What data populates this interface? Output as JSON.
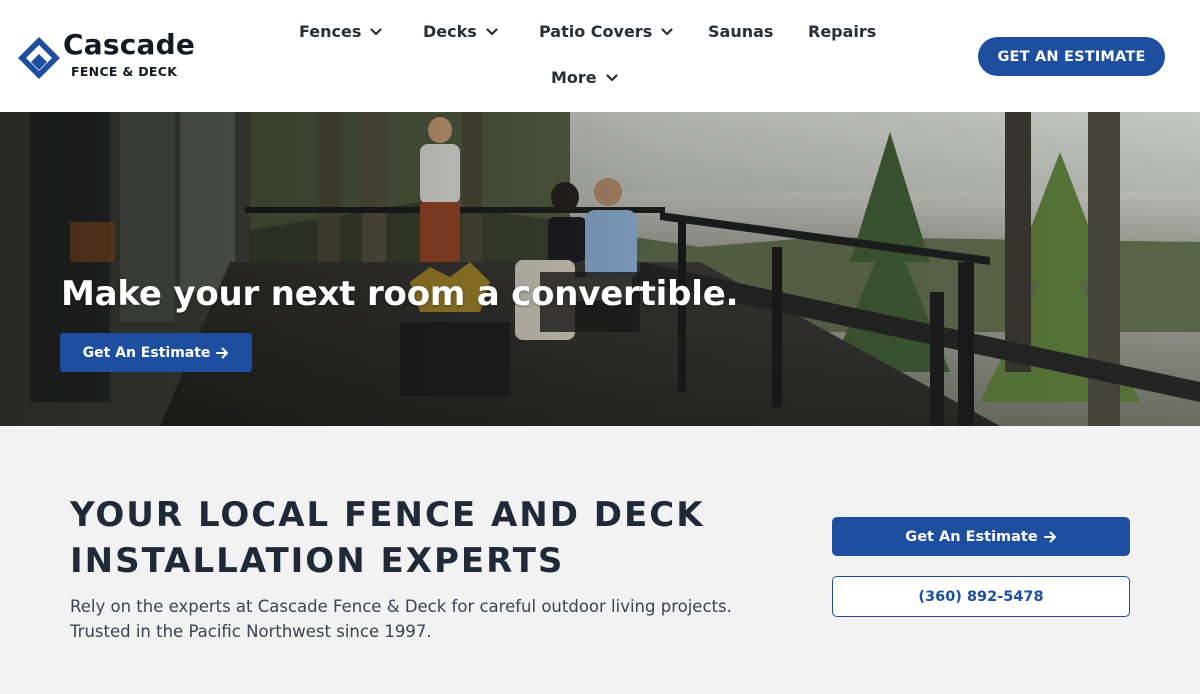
{
  "brand": {
    "name": "Cascade",
    "tagline": "FENCE & DECK",
    "color": "#1e4ea0"
  },
  "nav": {
    "items": [
      {
        "label": "Fences",
        "has_dropdown": true
      },
      {
        "label": "Decks",
        "has_dropdown": true
      },
      {
        "label": "Patio Covers",
        "has_dropdown": true
      },
      {
        "label": "Saunas",
        "has_dropdown": false
      },
      {
        "label": "Repairs",
        "has_dropdown": false
      },
      {
        "label": "More",
        "has_dropdown": true
      }
    ],
    "cta_label": "GET AN ESTIMATE"
  },
  "hero": {
    "title": "Make your next room a convertible.",
    "cta_label": "Get An Estimate",
    "cta_icon": "arrow-right-icon"
  },
  "intro": {
    "heading_lines": [
      "YOUR LOCAL FENCE AND DECK",
      "INSTALLATION EXPERTS"
    ],
    "body_lines": [
      "Rely on the experts at Cascade Fence & Deck for careful outdoor living projects.",
      "Trusted in the Pacific Northwest since 1997."
    ],
    "estimate_label": "Get An Estimate",
    "phone_label": "(360) 892-5478"
  }
}
